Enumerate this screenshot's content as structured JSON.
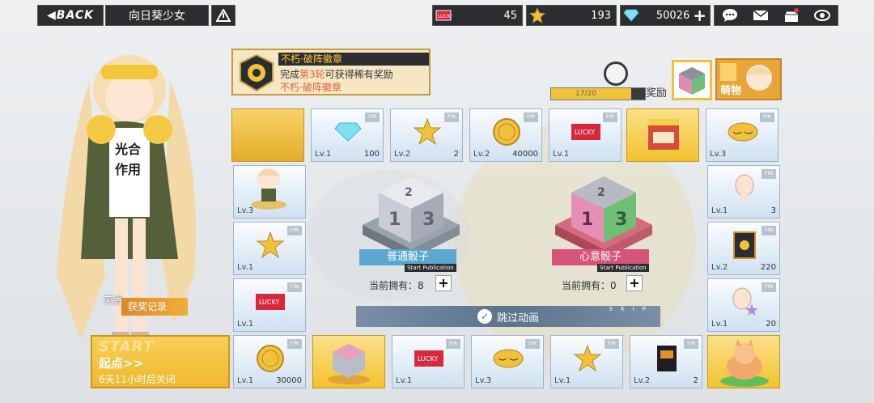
{
  "topbar": {
    "back_label": "BACK",
    "title": "向日葵少女"
  },
  "resources": [
    {
      "name": "ticket",
      "value": "45"
    },
    {
      "name": "star-coin",
      "value": "193"
    },
    {
      "name": "diamond",
      "value": "50026"
    }
  ],
  "mission": {
    "title": "不朽·破阵徽章",
    "line1_a": "完成",
    "line1_b": "第3轮",
    "line1_c": "可获得稀有奖励",
    "line2": "不朽·破阵徽章"
  },
  "reward": {
    "progress_text": "17/20",
    "progress": 0.85,
    "label": "奖励",
    "mengwu_label": "萌物"
  },
  "board": {
    "top_row": [
      {
        "lv": "",
        "count": ""
      },
      {
        "lv": "Lv.1",
        "count": "100",
        "item": "diamond"
      },
      {
        "lv": "Lv.2",
        "count": "2",
        "item": "star-coin"
      },
      {
        "lv": "Lv.2",
        "count": "40000",
        "item": "gold-coin"
      },
      {
        "lv": "Lv.1",
        "count": "",
        "item": "lucky-ticket"
      },
      {
        "lv": "",
        "count": "",
        "item": "shop-stand"
      },
      {
        "lv": "Lv.3",
        "count": "",
        "item": "eye-mask"
      }
    ],
    "left_col": [
      {
        "lv": "Lv.3",
        "count": "",
        "item": "chibi-figure"
      },
      {
        "lv": "Lv.1",
        "count": "",
        "item": "star-coin"
      },
      {
        "lv": "Lv.1",
        "count": "",
        "item": "lucky-ticket"
      }
    ],
    "right_col": [
      {
        "lv": "Lv.1",
        "count": "3",
        "item": "head-model"
      },
      {
        "lv": "Lv.2",
        "count": "220",
        "item": "card-pack"
      },
      {
        "lv": "Lv.1",
        "count": "20",
        "item": "head-model-star"
      }
    ],
    "bottom_row": [
      {
        "lv": "Lv.1",
        "count": "30000",
        "item": "gold-coin"
      },
      {
        "lv": "",
        "count": "",
        "item": "dice-figure"
      },
      {
        "lv": "Lv.1",
        "count": "",
        "item": "lucky-ticket"
      },
      {
        "lv": "Lv.3",
        "count": "",
        "item": "eye-mask"
      },
      {
        "lv": "Lv.1",
        "count": "",
        "item": "star-coin"
      },
      {
        "lv": "Lv.2",
        "count": "2",
        "item": "book"
      },
      {
        "lv": "",
        "count": "",
        "item": "cat-figure"
      }
    ],
    "start": {
      "big": "START",
      "title": "起点>>",
      "timer": "6天11小时后关闭"
    }
  },
  "dice": {
    "normal": {
      "label": "普通骰子",
      "pub": "Start Publication",
      "owned_label": "当前拥有：",
      "owned": "8"
    },
    "wish": {
      "label": "心意骰子",
      "pub": "Start Publication",
      "owned_label": "当前拥有：",
      "owned": "0"
    }
  },
  "skip": {
    "label": "跳过动画",
    "sk": "SKIP"
  },
  "character": {
    "name": "芙香",
    "log_label": "获奖记录"
  },
  "colors": {
    "gold": "#f4c22e",
    "dark": "#2b2d30",
    "tile_blue": "#cfe1f1"
  }
}
